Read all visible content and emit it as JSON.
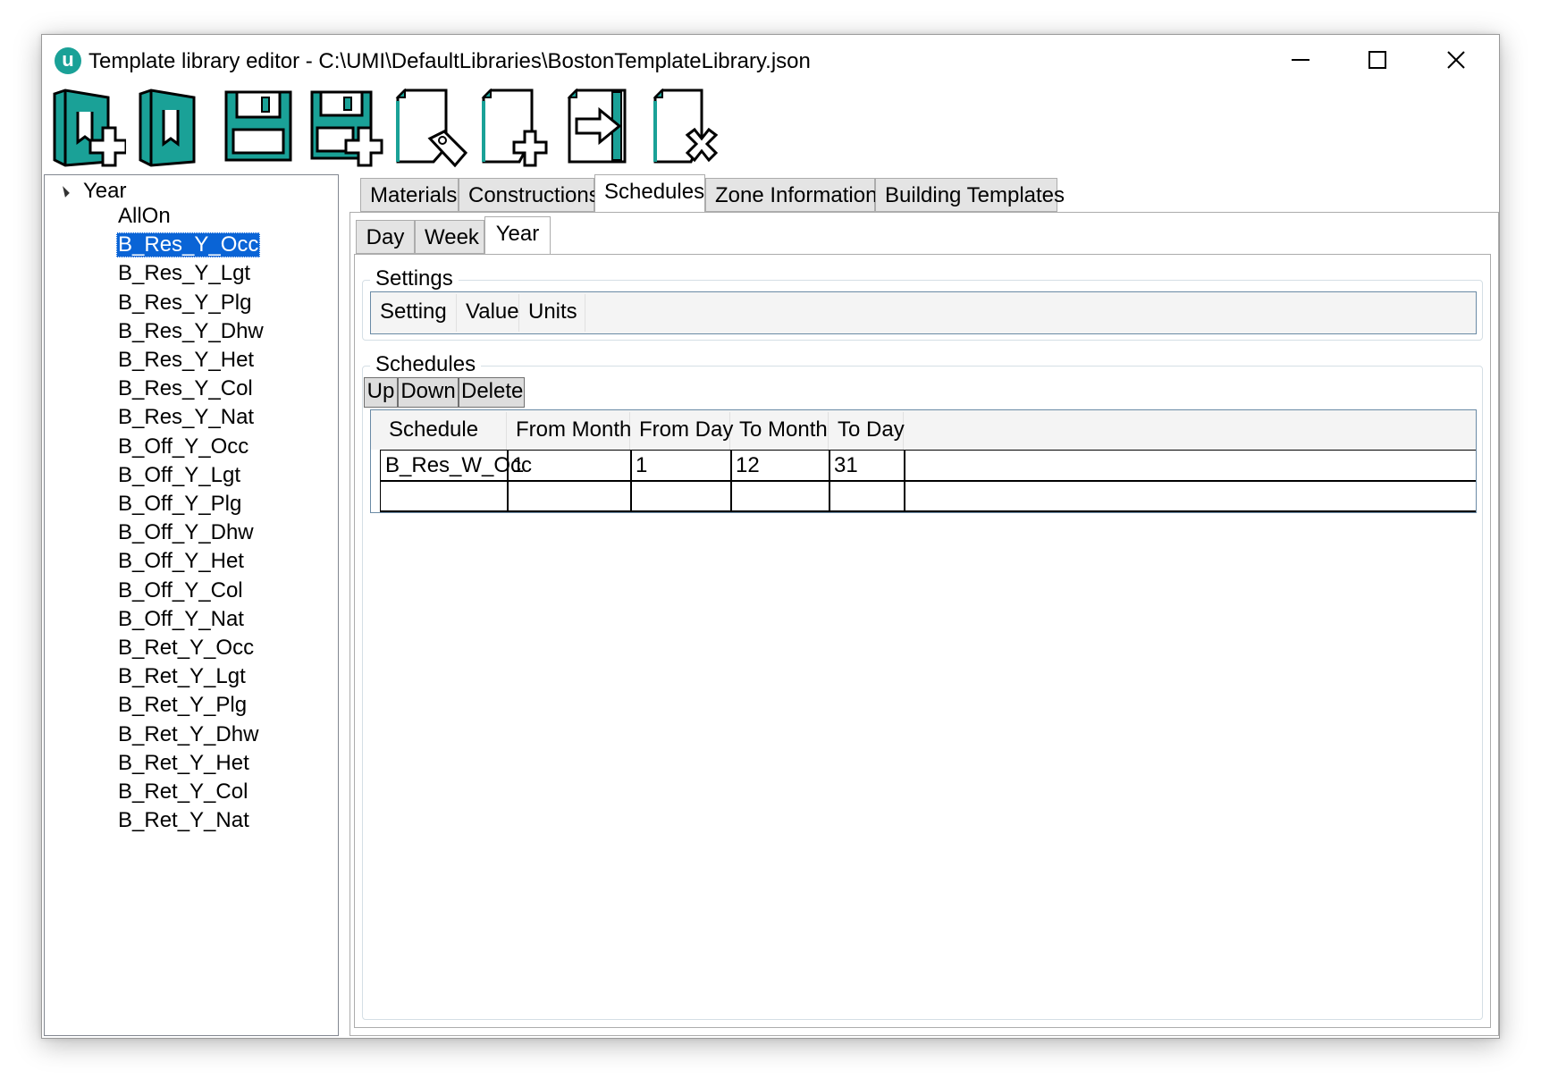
{
  "window": {
    "title": "Template library editor - C:\\UMI\\DefaultLibraries\\BostonTemplateLibrary.json",
    "app_icon_letter": "u",
    "controls": [
      "minimize-icon",
      "maximize-icon",
      "close-icon"
    ]
  },
  "toolbar": {
    "buttons": [
      {
        "icon": "new-library-icon"
      },
      {
        "icon": "open-library-icon"
      },
      {
        "icon": "save-icon"
      },
      {
        "icon": "save-as-icon"
      },
      {
        "icon": "tag-document-icon"
      },
      {
        "icon": "new-document-icon"
      },
      {
        "icon": "export-document-icon"
      },
      {
        "icon": "delete-document-icon"
      }
    ]
  },
  "tree": {
    "root_label": "Year",
    "selected": "B_Res_Y_Occ",
    "items": [
      "AllOn",
      "B_Res_Y_Occ",
      "B_Res_Y_Lgt",
      "B_Res_Y_Plg",
      "B_Res_Y_Dhw",
      "B_Res_Y_Het",
      "B_Res_Y_Col",
      "B_Res_Y_Nat",
      "B_Off_Y_Occ",
      "B_Off_Y_Lgt",
      "B_Off_Y_Plg",
      "B_Off_Y_Dhw",
      "B_Off_Y_Het",
      "B_Off_Y_Col",
      "B_Off_Y_Nat",
      "B_Ret_Y_Occ",
      "B_Ret_Y_Lgt",
      "B_Ret_Y_Plg",
      "B_Ret_Y_Dhw",
      "B_Ret_Y_Het",
      "B_Ret_Y_Col",
      "B_Ret_Y_Nat"
    ]
  },
  "tabs": {
    "main": [
      "Materials",
      "Constructions",
      "Schedules",
      "Zone Information",
      "Building Templates"
    ],
    "main_active": "Schedules",
    "sub": [
      "Day",
      "Week",
      "Year"
    ],
    "sub_active": "Year"
  },
  "settings": {
    "title": "Settings",
    "columns": [
      "Setting",
      "Value",
      "Units"
    ]
  },
  "schedules": {
    "title": "Schedules",
    "buttons": [
      "Up",
      "Down",
      "Delete"
    ],
    "columns": [
      "Schedule",
      "From Month",
      "From Day",
      "To Month",
      "To Day"
    ],
    "rows": [
      [
        "B_Res_W_Occ",
        "1",
        "1",
        "12",
        "31"
      ],
      [
        "",
        "",
        "",
        "",
        ""
      ]
    ]
  },
  "colors": {
    "accent": "#1aa197",
    "selection": "#0a64d6"
  }
}
